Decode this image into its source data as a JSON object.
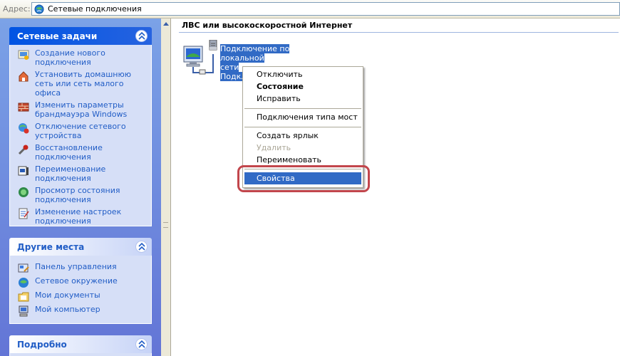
{
  "address_bar": {
    "label": "Адрес:",
    "value": "Сетевые подключения"
  },
  "task_pane": {
    "network_tasks": {
      "title": "Сетевые задачи",
      "items": [
        {
          "label": "Создание нового подключения",
          "icon": "new-connection-icon"
        },
        {
          "label": "Установить домашнюю сеть или сеть малого офиса",
          "icon": "home-network-icon"
        },
        {
          "label": "Изменить параметры брандмауэра Windows",
          "icon": "firewall-icon"
        },
        {
          "label": "Отключение сетевого устройства",
          "icon": "disable-device-icon"
        },
        {
          "label": "Восстановление подключения",
          "icon": "repair-icon"
        },
        {
          "label": "Переименование подключения",
          "icon": "rename-icon"
        },
        {
          "label": "Просмотр состояния подключения",
          "icon": "status-icon"
        },
        {
          "label": "Изменение настроек подключения",
          "icon": "settings-icon"
        }
      ]
    },
    "other_places": {
      "title": "Другие места",
      "items": [
        {
          "label": "Панель управления",
          "icon": "control-panel-icon"
        },
        {
          "label": "Сетевое окружение",
          "icon": "network-places-icon"
        },
        {
          "label": "Мои документы",
          "icon": "my-documents-icon"
        },
        {
          "label": "Мой компьютер",
          "icon": "my-computer-icon"
        }
      ]
    },
    "details": {
      "title": "Подробно"
    }
  },
  "content": {
    "group_header": "ЛВС или высокоскоростной Интернет",
    "connection": {
      "name_line1": "Подключение по локальной",
      "name_line2": "сети",
      "name_line3": "Подкл"
    }
  },
  "context_menu": {
    "items": [
      {
        "label": "Отключить",
        "state": "normal"
      },
      {
        "label": "Состояние",
        "state": "default"
      },
      {
        "label": "Исправить",
        "state": "normal"
      },
      {
        "label": "Подключения типа мост",
        "state": "normal"
      },
      {
        "label": "Создать ярлык",
        "state": "normal"
      },
      {
        "label": "Удалить",
        "state": "disabled"
      },
      {
        "label": "Переименовать",
        "state": "normal"
      },
      {
        "label": "Свойства",
        "state": "selected"
      }
    ]
  },
  "colors": {
    "selection": "#316ac5",
    "link": "#215dc6",
    "annotation_outline": "#c2464c",
    "task_pane_bg": "#7ba2e7"
  }
}
